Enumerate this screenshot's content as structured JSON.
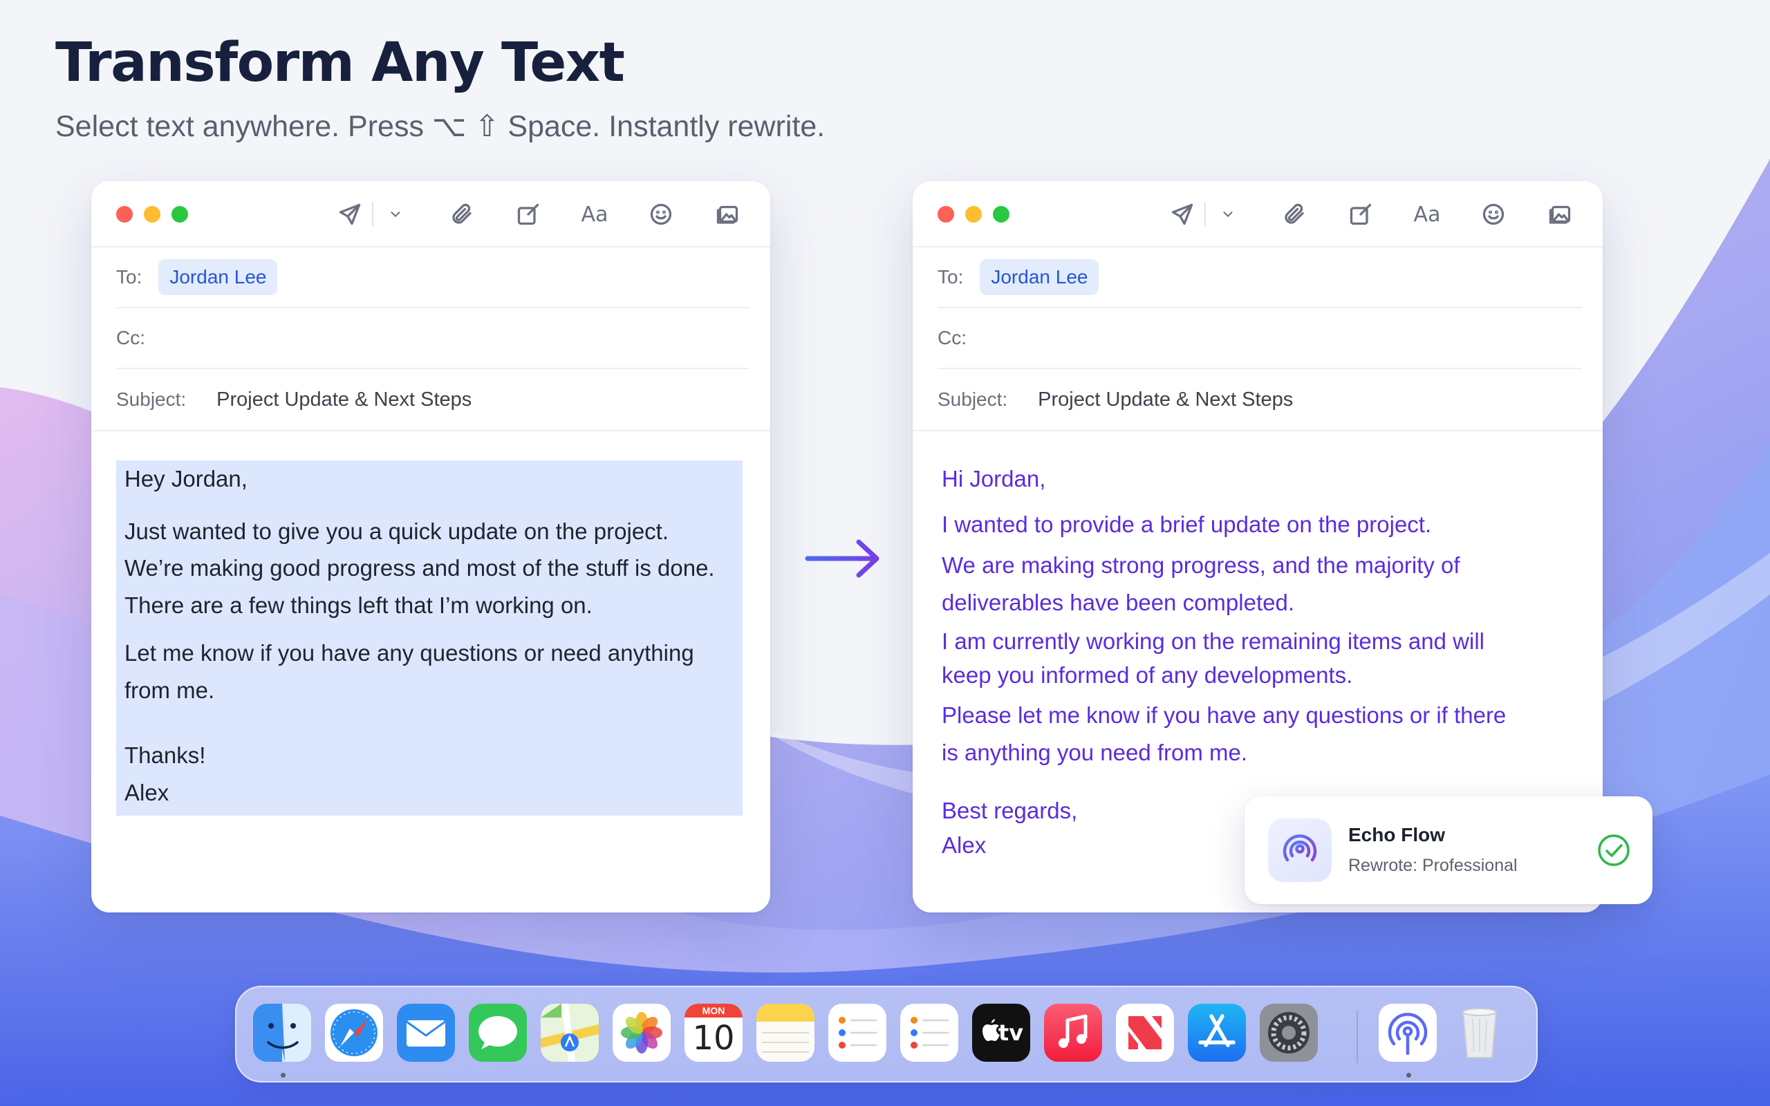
{
  "header": {
    "title": "Transform Any Text",
    "subtitle": "Select text anywhere. Press ⌥ ⇧ Space. Instantly rewrite."
  },
  "mail_before": {
    "to_label": "To:",
    "to_value": "Jordan Lee",
    "cc_label": "Cc:",
    "subject_label": "Subject:",
    "subject_value": "Project Update & Next Steps",
    "body": [
      "Hey Jordan,",
      "Just wanted to give you a quick update on the project.",
      "We’re making good progress and most of the stuff is done.",
      "There are a few things left that I’m working on.",
      "Let me know if you have any questions or need anything",
      "from me.",
      "Thanks!",
      "Alex"
    ]
  },
  "mail_after": {
    "to_label": "To:",
    "to_value": "Jordan Lee",
    "cc_label": "Cc:",
    "subject_label": "Subject:",
    "subject_value": "Project Update & Next Steps",
    "body": [
      "Hi Jordan,",
      "I wanted to provide a brief update on the project.",
      "We are making strong progress, and the majority of",
      "deliverables have been completed.",
      "I am currently working on the remaining items and will",
      "keep you informed of any developments.",
      "Please let me know if you have any questions or if there",
      "is anything you need from me.",
      "Best regards,",
      "Alex"
    ]
  },
  "toolbar": {
    "icons": [
      "send-icon",
      "chevron-down-icon",
      "paperclip-icon",
      "compose-icon",
      "font-icon",
      "emoji-icon",
      "photo-icon"
    ],
    "font_label": "Aa"
  },
  "toast": {
    "app_name": "Echo Flow",
    "status": "Rewrote: Professional"
  },
  "dock": {
    "apps": [
      "Finder",
      "Safari",
      "Mail",
      "Messages",
      "Maps",
      "Photos",
      "Calendar",
      "Notes",
      "Reminders",
      "Reminders",
      "Apple TV",
      "Music",
      "News",
      "App Store",
      "System Settings",
      "Echo Flow",
      "Trash"
    ],
    "calendar_month": "MON",
    "calendar_day": "10",
    "tv_label": "tv"
  },
  "colors": {
    "accent_purple": "#5a2cdf",
    "selection_blue": "#dce7fd",
    "chip_blue": "#2456d6",
    "success_green": "#2fb84a"
  }
}
